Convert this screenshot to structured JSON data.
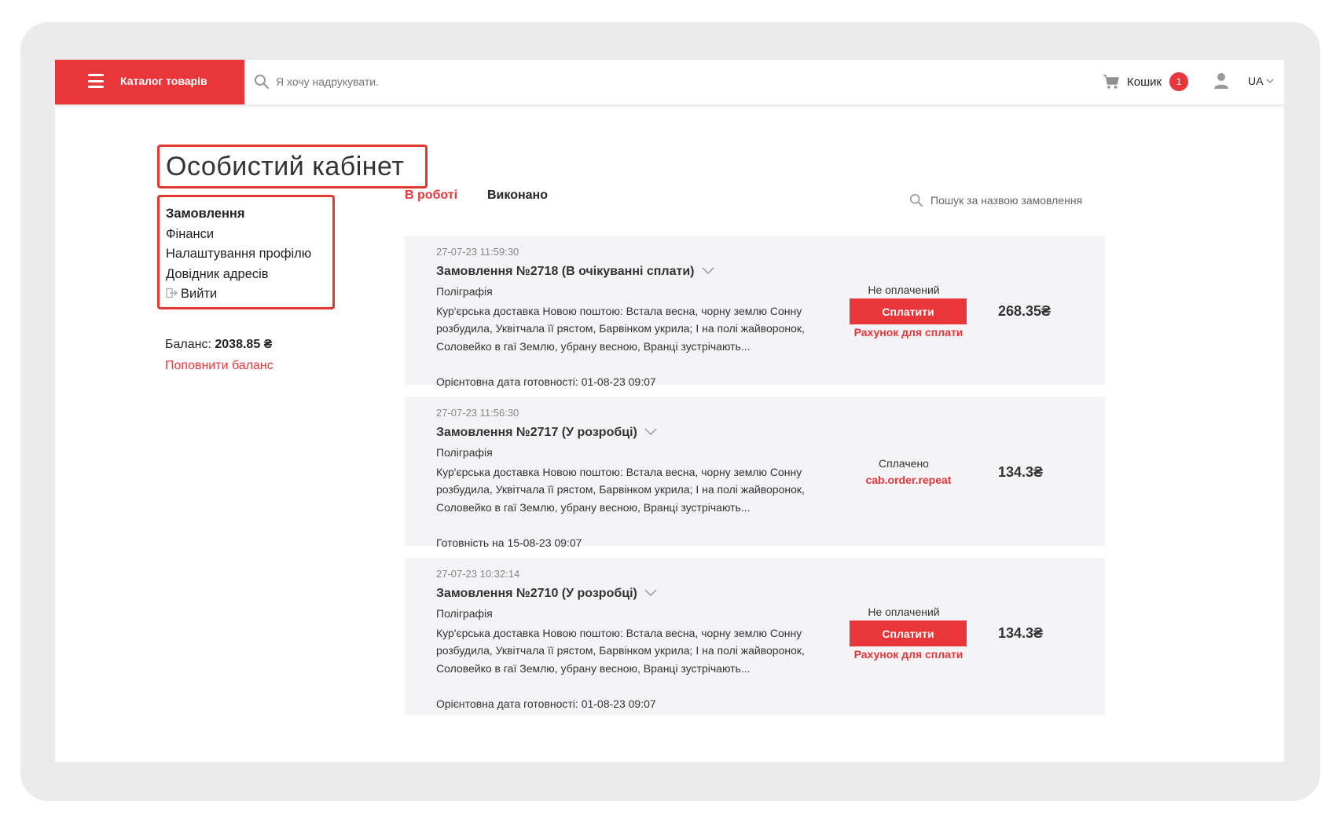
{
  "header": {
    "catalog_label": "Каталог товарів",
    "search_placeholder": "Я хочу надрукувати.",
    "cart_label": "Кошик",
    "cart_count": "1",
    "language": "UA"
  },
  "page_title": "Особистий кабінет",
  "menu": {
    "items": [
      "Замовлення",
      "Фінанси",
      "Налаштування профілю",
      "Довідник адресів"
    ],
    "logout": "Вийти"
  },
  "balance": {
    "label": "Баланс:",
    "amount": "2038.85 ₴",
    "topup": "Поповнити баланс"
  },
  "tabs": {
    "active": "В роботі",
    "done": "Виконано"
  },
  "order_search_placeholder": "Пошук за назвою замовлення",
  "orders": [
    {
      "date": "27-07-23 11:59:30",
      "title": "Замовлення №2718 (В очікуванні сплати)",
      "category": "Поліграфія",
      "description": "Кур'єрська доставка Новою поштою: Встала весна, чорну землю Сонну розбудила, Уквітчала її рястом, Барвінком укрила; І на полі жайворонок, Соловейко в гаї Землю, убрану весною, Вранці зустрічають...",
      "ready": "Орієнтовна дата готовності: 01-08-23 09:07",
      "status": "Не оплачений",
      "pay_label": "Сплатити",
      "link": "Рахунок для сплати",
      "price": "268.35₴"
    },
    {
      "date": "27-07-23 11:56:30",
      "title": "Замовлення №2717 (У розробці)",
      "category": "Поліграфія",
      "description": "Кур'єрська доставка Новою поштою: Встала весна, чорну землю Сонну розбудила, Уквітчала її рястом, Барвінком укрила; І на полі жайворонок, Соловейко в гаї Землю, убрану весною, Вранці зустрічають...",
      "ready": "Готовність на 15-08-23 09:07",
      "status": "Сплачено",
      "link": "cab.order.repeat",
      "price": "134.3₴"
    },
    {
      "date": "27-07-23 10:32:14",
      "title": "Замовлення №2710 (У розробці)",
      "category": "Поліграфія",
      "description": "Кур'єрська доставка Новою поштою: Встала весна, чорну землю Сонну розбудила, Уквітчала її рястом, Барвінком укрила; І на полі жайворонок, Соловейко в гаї Землю, убрану весною, Вранці зустрічають...",
      "ready": "Орієнтовна дата готовності: 01-08-23 09:07",
      "status": "Не оплачений",
      "pay_label": "Сплатити",
      "link": "Рахунок для сплати",
      "price": "134.3₴"
    }
  ],
  "colors": {
    "accent": "#e8363a",
    "highlight_box": "#e0392f",
    "order_bg": "#f4f3f5"
  }
}
